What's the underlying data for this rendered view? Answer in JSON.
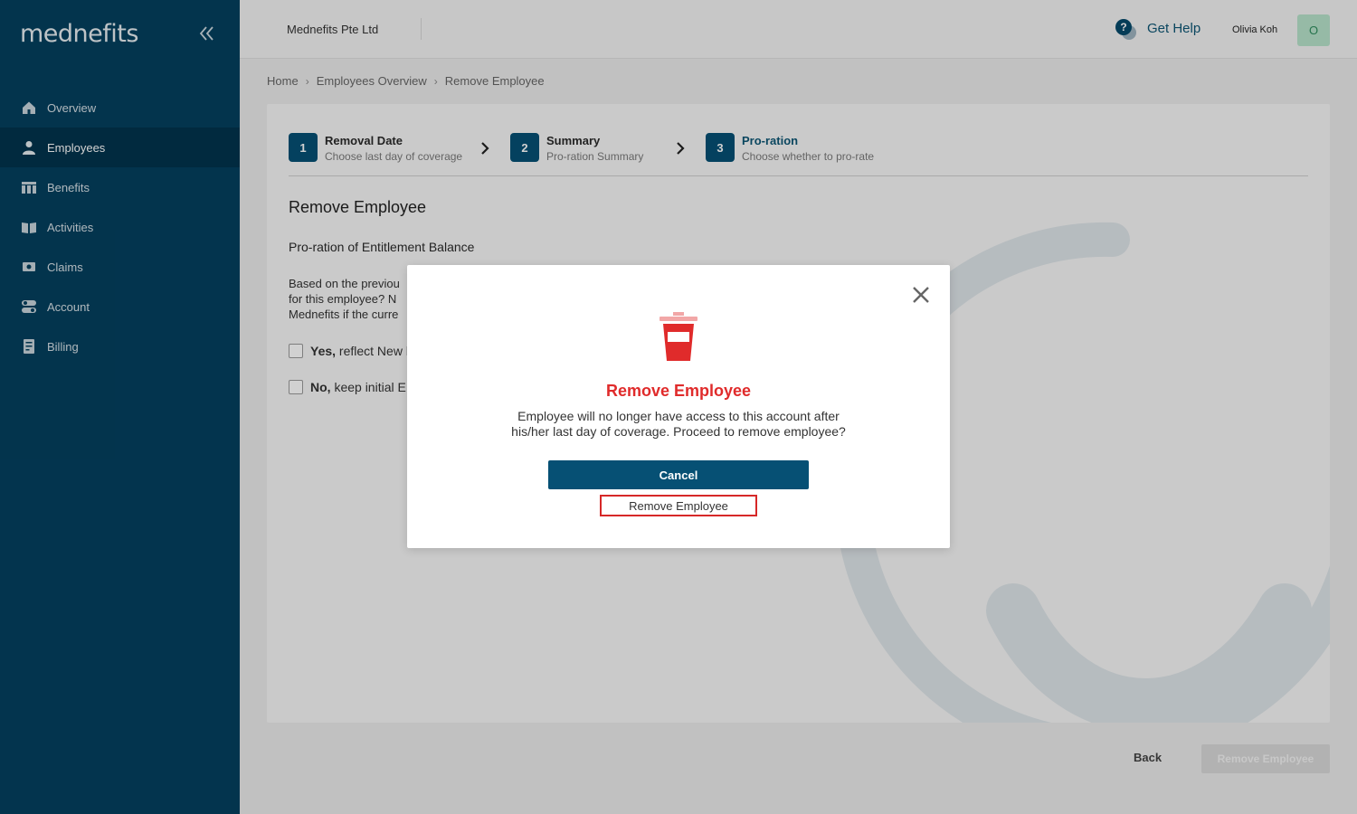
{
  "brand": {
    "logo_text": "mednefits",
    "primary_color": "#04405f",
    "accent_color": "#065074",
    "danger_color": "#e02b2b"
  },
  "sidebar": {
    "items": [
      {
        "label": "Overview",
        "icon": "home-icon"
      },
      {
        "label": "Employees",
        "icon": "person-icon",
        "active": true
      },
      {
        "label": "Benefits",
        "icon": "table-icon"
      },
      {
        "label": "Activities",
        "icon": "book-icon"
      },
      {
        "label": "Claims",
        "icon": "money-icon"
      },
      {
        "label": "Account",
        "icon": "toggle-icon"
      },
      {
        "label": "Billing",
        "icon": "invoice-icon"
      }
    ]
  },
  "topbar": {
    "company": "Mednefits Pte Ltd",
    "help_label": "Get Help",
    "user_name": "Olivia Koh",
    "avatar_initial": "O"
  },
  "breadcrumb": [
    "Home",
    "Employees Overview",
    "Remove Employee"
  ],
  "steps": [
    {
      "number": "1",
      "title": "Removal Date",
      "subtitle": "Choose last day of coverage"
    },
    {
      "number": "2",
      "title": "Summary",
      "subtitle": "Pro-ration Summary"
    },
    {
      "number": "3",
      "title": "Pro-ration",
      "subtitle": "Choose whether to pro-rate",
      "current": true
    }
  ],
  "page": {
    "title": "Remove Employee",
    "section_title": "Pro-ration of Entitlement Balance",
    "description_lines": [
      "Based on the previou",
      "for this employee? N",
      "Mednefits if the curre"
    ],
    "options": [
      {
        "bold": "Yes,",
        "text": " reflect New l"
      },
      {
        "bold": "No,",
        "text": " keep initial E"
      }
    ]
  },
  "footer": {
    "back_label": "Back",
    "remove_label": "Remove Employee"
  },
  "modal": {
    "title": "Remove Employee",
    "text_line1": "Employee will no longer have access to this account after",
    "text_line2": "his/her last day of coverage. Proceed to remove employee?",
    "cancel_label": "Cancel",
    "remove_label": "Remove Employee"
  }
}
